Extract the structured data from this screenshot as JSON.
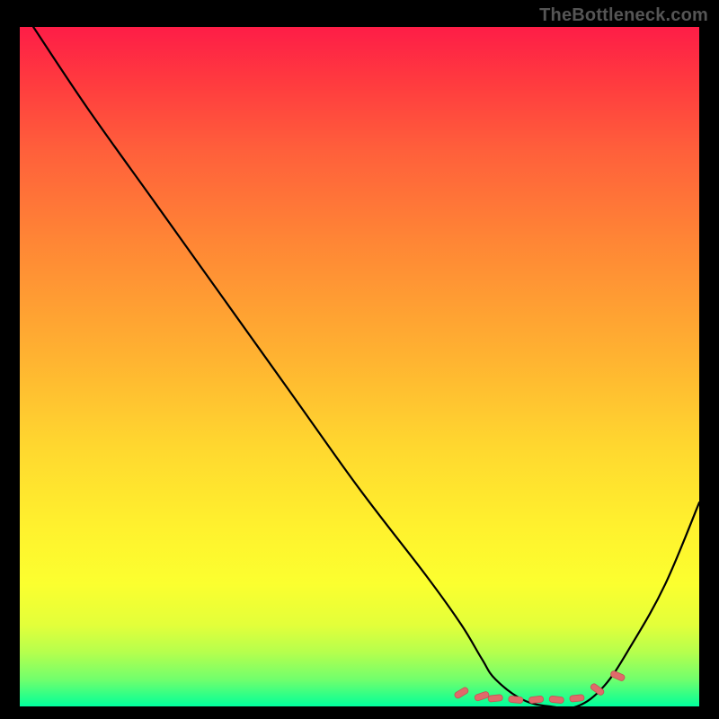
{
  "watermark": "TheBottleneck.com",
  "colors": {
    "black": "#000000",
    "curve": "#000000",
    "markers": "#e06a6a",
    "markers_stroke": "#c25555",
    "gradient_top": "#fe1d47",
    "gradient_bottom": "#00ff9e"
  },
  "chart_data": {
    "type": "line",
    "title": "",
    "subtitle": "",
    "xlabel": "",
    "ylabel": "",
    "xlim": [
      0,
      100
    ],
    "ylim": [
      0,
      100
    ],
    "grid": false,
    "legend": false,
    "annotations": [
      "TheBottleneck.com"
    ],
    "series": [
      {
        "name": "bottleneck-curve",
        "x": [
          2,
          10,
          20,
          30,
          40,
          50,
          60,
          65,
          68,
          70,
          74,
          78,
          82,
          86,
          90,
          95,
          100
        ],
        "y": [
          100,
          88,
          74,
          60,
          46,
          32,
          19,
          12,
          7,
          4,
          1,
          0,
          0,
          3,
          9,
          18,
          30
        ]
      }
    ],
    "markers": {
      "name": "highlighted-region",
      "x": [
        65,
        68,
        70,
        73,
        76,
        79,
        82,
        85,
        88
      ],
      "y": [
        2,
        1.5,
        1.2,
        1,
        1,
        1,
        1.2,
        2.5,
        4.5
      ]
    }
  }
}
